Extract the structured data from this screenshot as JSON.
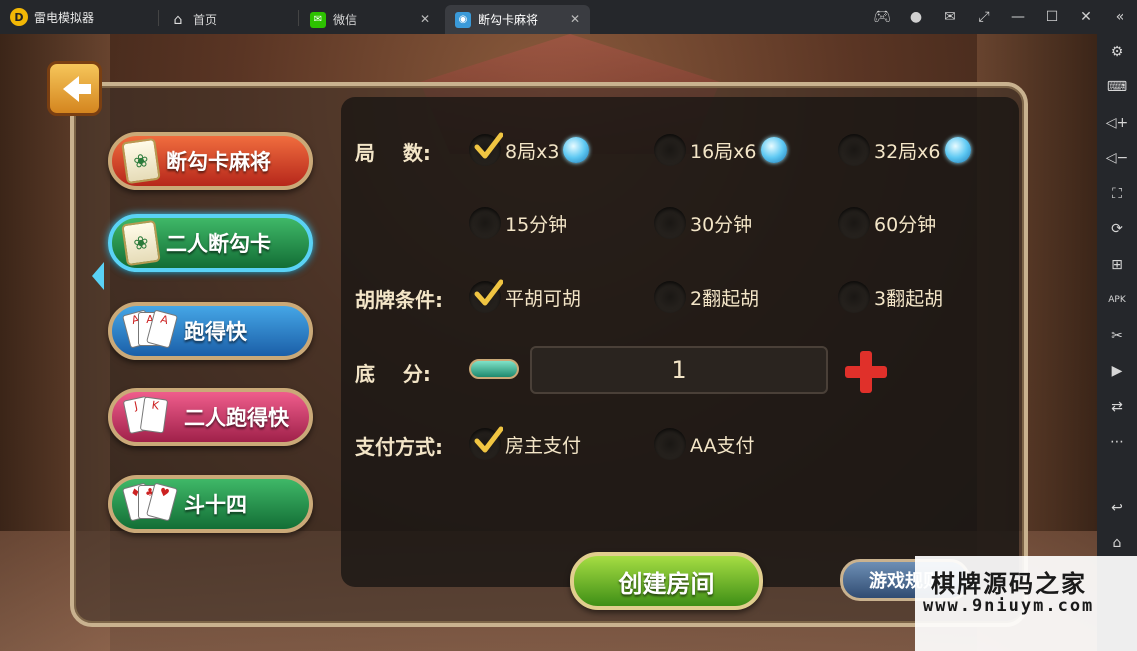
{
  "app": {
    "name": "雷电模拟器"
  },
  "tabs": [
    {
      "label": "首页",
      "icon": "home-icon"
    },
    {
      "label": "微信",
      "icon": "wechat-icon"
    },
    {
      "label": "断勾卡麻将",
      "icon": "game-icon",
      "active": true
    }
  ],
  "window_controls": [
    "gamepad-icon",
    "user-icon",
    "mail-icon",
    "restore-icon",
    "minimize-icon",
    "maximize-icon",
    "close-icon",
    "collapse-icon"
  ],
  "sidebar_tools": [
    "settings-icon",
    "keyboard-icon",
    "volume-up-icon",
    "volume-down-icon",
    "fullscreen-icon",
    "record-icon",
    "add-window-icon",
    "apk-icon",
    "scissors-icon",
    "video-icon",
    "sync-icon",
    "more-icon",
    "back-icon",
    "home-icon"
  ],
  "game_list": [
    {
      "label": "断勾卡麻将",
      "style": "red",
      "art": "mahjong"
    },
    {
      "label": "二人断勾卡",
      "style": "green",
      "art": "mahjong",
      "selected": true
    },
    {
      "label": "跑得快",
      "style": "blue",
      "art": "cards"
    },
    {
      "label": "二人跑得快",
      "style": "pink",
      "art": "cards"
    },
    {
      "label": "斗十四",
      "style": "green",
      "art": "cards"
    }
  ],
  "settings": {
    "rounds_label": "局    数:",
    "rounds": [
      {
        "label": "8局x3",
        "checked": true,
        "gem": true
      },
      {
        "label": "16局x6",
        "checked": false,
        "gem": true
      },
      {
        "label": "32局x6",
        "checked": false,
        "gem": true
      }
    ],
    "time_options": [
      {
        "label": "15分钟",
        "checked": false
      },
      {
        "label": "30分钟",
        "checked": false
      },
      {
        "label": "60分钟",
        "checked": false
      }
    ],
    "hu_label": "胡牌条件:",
    "hu_options": [
      {
        "label": "平胡可胡",
        "checked": true
      },
      {
        "label": "2翻起胡",
        "checked": false
      },
      {
        "label": "3翻起胡",
        "checked": false
      }
    ],
    "base_label": "底    分:",
    "base_value": "1",
    "pay_label": "支付方式:",
    "pay_options": [
      {
        "label": "房主支付",
        "checked": true
      },
      {
        "label": "AA支付",
        "checked": false
      }
    ]
  },
  "actions": {
    "create": "创建房间",
    "rules": "游戏规则"
  },
  "watermark": {
    "title": "棋牌源码之家",
    "url": "www.9niuym.com"
  },
  "colors": {
    "accent_check": "#f0c542",
    "text": "#f3e5c7",
    "selected_glow": "#5ad2f5"
  }
}
